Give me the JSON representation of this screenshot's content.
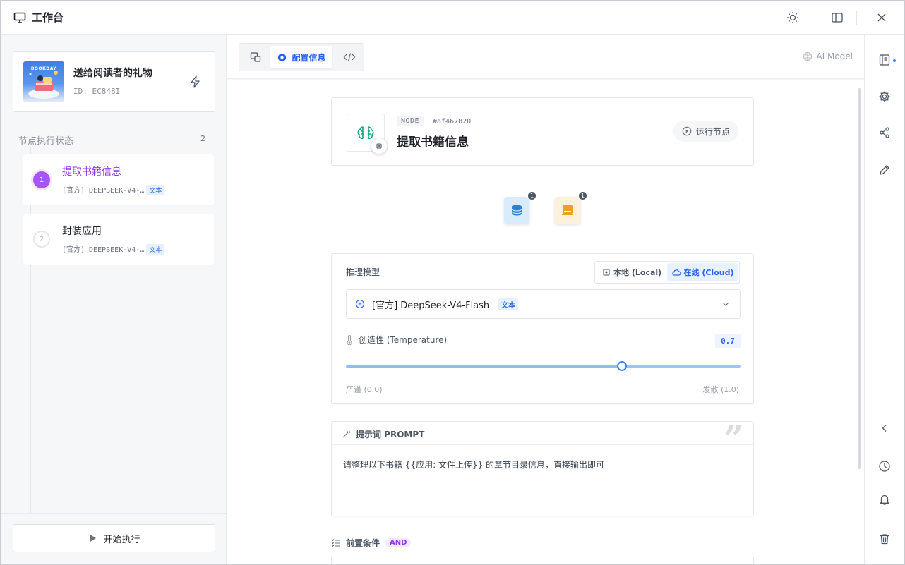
{
  "window": {
    "title": "工作台",
    "icons": [
      "monitor-icon",
      "sun-icon",
      "sidebar-toggle-icon",
      "close-icon"
    ]
  },
  "sidebar": {
    "app": {
      "name": "送给阅读者的礼物",
      "id": "ID: EC848I",
      "thumb_label": "BOOKDAY"
    },
    "status_heading": "节点执行状态",
    "status_count": "2",
    "nodes": [
      {
        "index": "1",
        "name": "提取书籍信息",
        "model": "[官方] DEEPSEEK-V4-…",
        "tag": "文本",
        "active": true
      },
      {
        "index": "2",
        "name": "封装应用",
        "model": "[官方] DEEPSEEK-V4-…",
        "tag": "文本",
        "active": false
      }
    ],
    "run_button": "开始执行"
  },
  "main": {
    "tabs": {
      "active_label": "配置信息"
    },
    "ai_model_label": "AI Model",
    "node": {
      "kind": "NODE",
      "hash": "#af467820",
      "title": "提取书籍信息",
      "run_label": "运行节点"
    },
    "io": [
      {
        "name": "database",
        "count": "1",
        "color": "#d9ecfb"
      },
      {
        "name": "output",
        "count": "1",
        "color": "#fdf1dc"
      }
    ],
    "model": {
      "label": "推理模型",
      "local_label": "本地 (Local)",
      "cloud_label": "在线 (Cloud)",
      "selected": "[官方] DeepSeek-V4-Flash",
      "selected_tag": "文本",
      "temperature_label": "创造性 (Temperature)",
      "temperature_value": "0.7",
      "temperature_fraction": 0.7,
      "min_label": "严谨 (0.0)",
      "max_label": "发散 (1.0)"
    },
    "prompt": {
      "title": "提示词 PROMPT",
      "body": "请整理以下书籍 {{应用: 文件上传}} 的章节目录信息，直接输出即可"
    },
    "preconditions": {
      "title": "前置条件",
      "tag": "AND"
    }
  },
  "colors": {
    "accent": "#2563eb",
    "active_node": "#a855f7"
  }
}
